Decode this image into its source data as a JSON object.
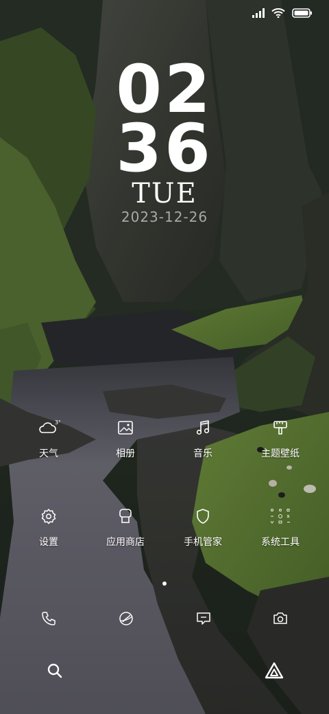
{
  "clock": {
    "hours": "02",
    "minutes": "36",
    "day": "TUE",
    "date": "2023-12-26"
  },
  "status_bar": {
    "icons": [
      "signal-icon",
      "wifi-icon",
      "battery-icon"
    ]
  },
  "apps_row1": [
    {
      "label": "天气",
      "icon": "cloud-icon",
      "badge": "3°"
    },
    {
      "label": "相册",
      "icon": "picture-icon"
    },
    {
      "label": "音乐",
      "icon": "music-note-icon"
    },
    {
      "label": "主题壁纸",
      "icon": "paint-brush-icon"
    }
  ],
  "apps_row2": [
    {
      "label": "设置",
      "icon": "gear-icon"
    },
    {
      "label": "应用商店",
      "icon": "store-icon"
    },
    {
      "label": "手机管家",
      "icon": "shield-icon"
    },
    {
      "label": "系统工具",
      "icon": "tools-folder-icon"
    }
  ],
  "dock": {
    "icons": [
      "phone-icon",
      "browser-icon",
      "message-icon",
      "camera-icon"
    ]
  },
  "bottom": {
    "icons": [
      "search-icon",
      "assistant-icon"
    ]
  },
  "colors": {
    "text": "#ffffff",
    "date_text": "#c8c8c8",
    "grass": "#5f7f3a",
    "rock": "#3a3e36",
    "river": "#6f6e78"
  }
}
